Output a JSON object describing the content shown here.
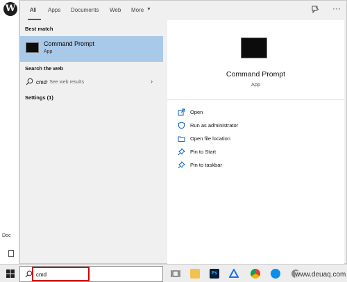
{
  "tabs": [
    {
      "label": "All"
    },
    {
      "label": "Apps"
    },
    {
      "label": "Documents"
    },
    {
      "label": "Web"
    },
    {
      "label": "More"
    }
  ],
  "left": {
    "best_match_heading": "Best match",
    "best_match": {
      "title": "Command Prompt",
      "subtitle": "App"
    },
    "web_heading": "Search the web",
    "web_result": {
      "query": "cmd",
      "hint": "- See web results"
    },
    "settings_heading": "Settings (1)"
  },
  "detail": {
    "title": "Command Prompt",
    "subtitle": "App",
    "actions": [
      {
        "label": "Open",
        "icon": "open-icon"
      },
      {
        "label": "Run as administrator",
        "icon": "shield-icon"
      },
      {
        "label": "Open file location",
        "icon": "folder-icon"
      },
      {
        "label": "Pin to Start",
        "icon": "pin-icon"
      },
      {
        "label": "Pin to taskbar",
        "icon": "pin-icon"
      }
    ]
  },
  "taskbar": {
    "search_value": "cmd",
    "apps": [
      "task-view-icon",
      "file-explorer-icon",
      "photoshop-icon",
      "app-icon",
      "chrome-icon",
      "teamviewer-icon"
    ]
  },
  "background": {
    "doc_label": "Doc"
  },
  "watermark": "www.deuaq.com",
  "colors": {
    "accent": "#0a5fbf",
    "selection": "#a9c9e9",
    "highlight_box": "#d00000"
  }
}
